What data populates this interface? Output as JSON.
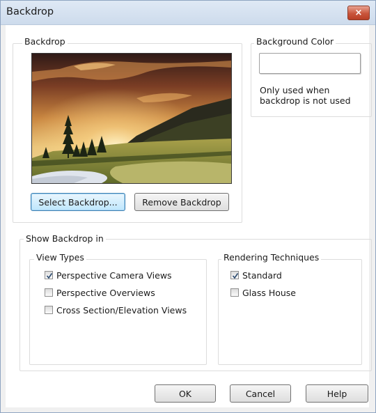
{
  "window": {
    "title": "Backdrop",
    "close_glyph": "×"
  },
  "backdrop_group": {
    "label": "Backdrop",
    "select_button": "Select Backdrop...",
    "remove_button": "Remove Backdrop"
  },
  "background_color": {
    "label": "Background Color",
    "swatch_color": "#ffffff",
    "note_line1": "Only used when",
    "note_line2": "backdrop is not used"
  },
  "show_in": {
    "label": "Show Backdrop in",
    "view_types": {
      "label": "View Types",
      "items": [
        {
          "label": "Perspective Camera Views",
          "checked": true
        },
        {
          "label": "Perspective Overviews",
          "checked": false
        },
        {
          "label": "Cross Section/Elevation Views",
          "checked": false
        }
      ]
    },
    "rendering": {
      "label": "Rendering Techniques",
      "items": [
        {
          "label": "Standard",
          "checked": true
        },
        {
          "label": "Glass House",
          "checked": false
        }
      ]
    }
  },
  "footer": {
    "ok": "OK",
    "cancel": "Cancel",
    "help": "Help"
  },
  "icons": {
    "close": "close-icon",
    "check": "checkmark-icon"
  }
}
